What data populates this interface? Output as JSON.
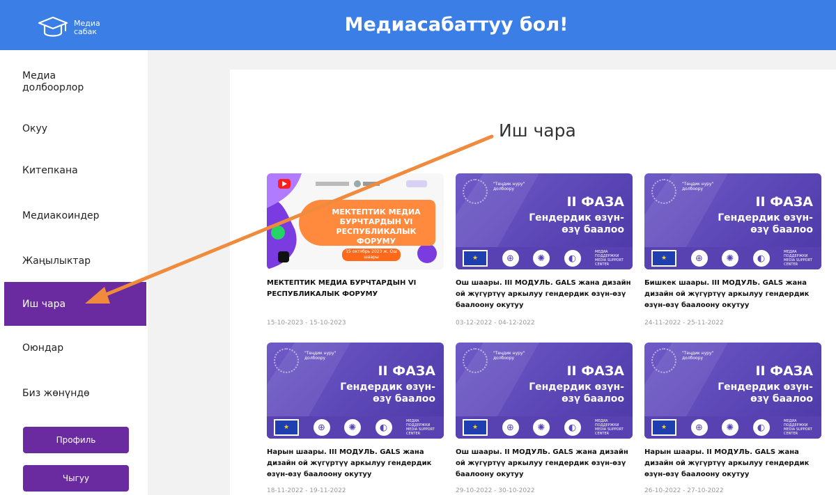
{
  "header": {
    "logo_line1": "Медиа",
    "logo_line2": "сабак",
    "title": "Медиасабаттуу бол!"
  },
  "sidebar": {
    "items": [
      {
        "label": "Медиа долбоорлор"
      },
      {
        "label": "Окуу"
      },
      {
        "label": "Китепкана"
      },
      {
        "label": "Медиакоиндер"
      },
      {
        "label": "Жаңылыктар"
      },
      {
        "label": "Иш чара",
        "active": true
      },
      {
        "label": "Оюндар"
      },
      {
        "label": "Биз жөнүндө"
      }
    ],
    "profile_button": "Профиль",
    "logout_button": "Чыгуу"
  },
  "main": {
    "heading": "Иш чара"
  },
  "cards": [
    {
      "image": "forum-poster",
      "poster_text": "МЕКТЕПТИК МЕДИА БУРЧТАРДЫН VI РЕСПУБЛИКАЛЫК ФОРУМУ",
      "poster_date": "15 октябрь 2023 ж. Ош шаары",
      "title": "МЕКТЕПТИК МЕДИА БУРЧТАРДЫН VI РЕСПУБЛИКАЛЫК ФОРУМУ",
      "date": "15-10-2023  -  15-10-2023"
    },
    {
      "image": "phase-banner",
      "title": "Ош шаары. III МОДУЛЬ. GALS жана дизайн ой жүгүртүү аркылуу гендердик өзүн-өзү баалоону окутуу",
      "date": "03-12-2022  -  04-12-2022"
    },
    {
      "image": "phase-banner",
      "title": "Бишкек шаары. III МОДУЛЬ. GALS жана дизайн ой жүгүртүү аркылуу гендердик өзүн-өзү баалоону окутуу",
      "date": "24-11-2022  -  25-11-2022"
    },
    {
      "image": "phase-banner",
      "title": "Нарын шаары. III МОДУЛЬ. GALS жана дизайн ой жүгүртүү аркылуу гендердик өзүн-өзү баалоону окутуу",
      "date": "18-11-2022  -  19-11-2022"
    },
    {
      "image": "phase-banner",
      "title": "Ош шаары. II МОДУЛЬ. GALS жана дизайн ой жүгүртүү аркылуу гендердик өзүн-өзү баалоону окутуу",
      "date": "29-10-2022  -  30-10-2022"
    },
    {
      "image": "phase-banner",
      "title": "Нарын шаары. II МОДУЛЬ. GALS жана дизайн ой жүгүртүү аркылуу гендердик өзүн-өзү баалоону окутуу",
      "date": "26-10-2022  -  27-10-2022"
    }
  ],
  "phase_banner": {
    "small_text": "\"Теңдик нуру\" долбоору",
    "title": "II ФАЗА",
    "subtitle": "Гендердик өзүн-өзү баалоо",
    "partner_text": "МЕДИА ПОДДЕРЖКИ MEDIA SUPPORT CENTER"
  },
  "colors": {
    "header": "#3a7ee6",
    "accent": "#6a2ba0",
    "arrow": "#f08a3c"
  }
}
